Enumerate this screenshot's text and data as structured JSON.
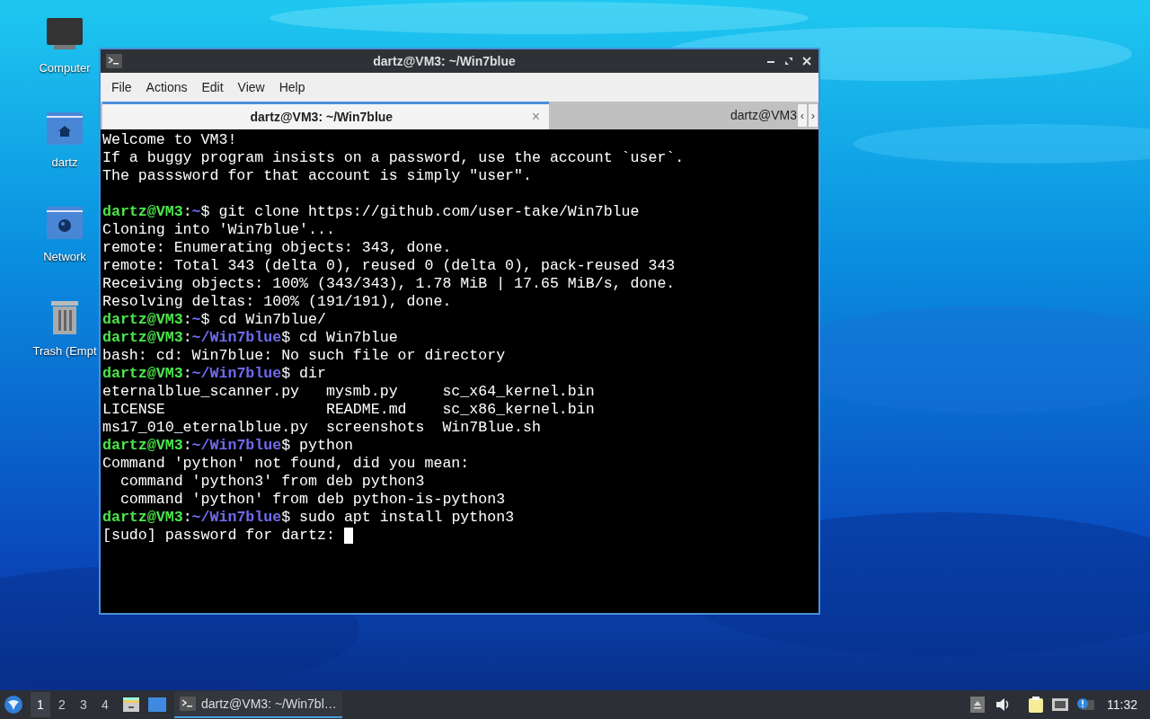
{
  "desktop_icons": [
    {
      "kind": "computer",
      "label": "Computer"
    },
    {
      "kind": "home",
      "label": "dartz"
    },
    {
      "kind": "network",
      "label": "Network"
    },
    {
      "kind": "trash",
      "label": "Trash (Empt"
    }
  ],
  "window": {
    "title": "dartz@VM3: ~/Win7blue",
    "menu": [
      "File",
      "Actions",
      "Edit",
      "View",
      "Help"
    ],
    "tabs": [
      {
        "label": "dartz@VM3: ~/Win7blue",
        "selected": true,
        "close": "×"
      },
      {
        "label": "dartz@VM3",
        "selected": false
      }
    ],
    "tab_scroll": [
      "‹",
      "›"
    ],
    "terminal": [
      {
        "kind": "output",
        "text": "Welcome to VM3!"
      },
      {
        "kind": "output",
        "text": "If a buggy program insists on a password, use the account `user`."
      },
      {
        "kind": "output",
        "text": "The passsword for that account is simply \"user\"."
      },
      {
        "kind": "blank"
      },
      {
        "kind": "prompt",
        "user": "dartz@VM3",
        "sep": ":",
        "path": "~",
        "command": "$ git clone https://github.com/user-take/Win7blue"
      },
      {
        "kind": "output",
        "text": "Cloning into 'Win7blue'..."
      },
      {
        "kind": "output",
        "text": "remote: Enumerating objects: 343, done."
      },
      {
        "kind": "output",
        "text": "remote: Total 343 (delta 0), reused 0 (delta 0), pack-reused 343"
      },
      {
        "kind": "output",
        "text": "Receiving objects: 100% (343/343), 1.78 MiB | 17.65 MiB/s, done."
      },
      {
        "kind": "output",
        "text": "Resolving deltas: 100% (191/191), done."
      },
      {
        "kind": "prompt",
        "user": "dartz@VM3",
        "sep": ":",
        "path": "~",
        "command": "$ cd Win7blue/"
      },
      {
        "kind": "prompt",
        "user": "dartz@VM3",
        "sep": ":",
        "path": "~/Win7blue",
        "command": "$ cd Win7blue"
      },
      {
        "kind": "output",
        "text": "bash: cd: Win7blue: No such file or directory"
      },
      {
        "kind": "prompt",
        "user": "dartz@VM3",
        "sep": ":",
        "path": "~/Win7blue",
        "command": "$ dir"
      },
      {
        "kind": "output",
        "text": "eternalblue_scanner.py   mysmb.py     sc_x64_kernel.bin"
      },
      {
        "kind": "output",
        "text": "LICENSE                  README.md    sc_x86_kernel.bin"
      },
      {
        "kind": "output",
        "text": "ms17_010_eternalblue.py  screenshots  Win7Blue.sh"
      },
      {
        "kind": "prompt",
        "user": "dartz@VM3",
        "sep": ":",
        "path": "~/Win7blue",
        "command": "$ python"
      },
      {
        "kind": "output",
        "text": "Command 'python' not found, did you mean:"
      },
      {
        "kind": "output",
        "text": "  command 'python3' from deb python3"
      },
      {
        "kind": "output",
        "text": "  command 'python' from deb python-is-python3"
      },
      {
        "kind": "prompt",
        "user": "dartz@VM3",
        "sep": ":",
        "path": "~/Win7blue",
        "command": "$ sudo apt install python3"
      },
      {
        "kind": "output",
        "text": "[sudo] password for dartz: ",
        "cursor": true
      }
    ]
  },
  "taskbar": {
    "workspaces": [
      {
        "label": "1",
        "selected": true
      },
      {
        "label": "2",
        "selected": false
      },
      {
        "label": "3",
        "selected": false
      },
      {
        "label": "4",
        "selected": false
      }
    ],
    "tasks": [
      {
        "label": "dartz@VM3: ~/Win7bl…",
        "selected": true
      }
    ],
    "clock": "11:32"
  }
}
